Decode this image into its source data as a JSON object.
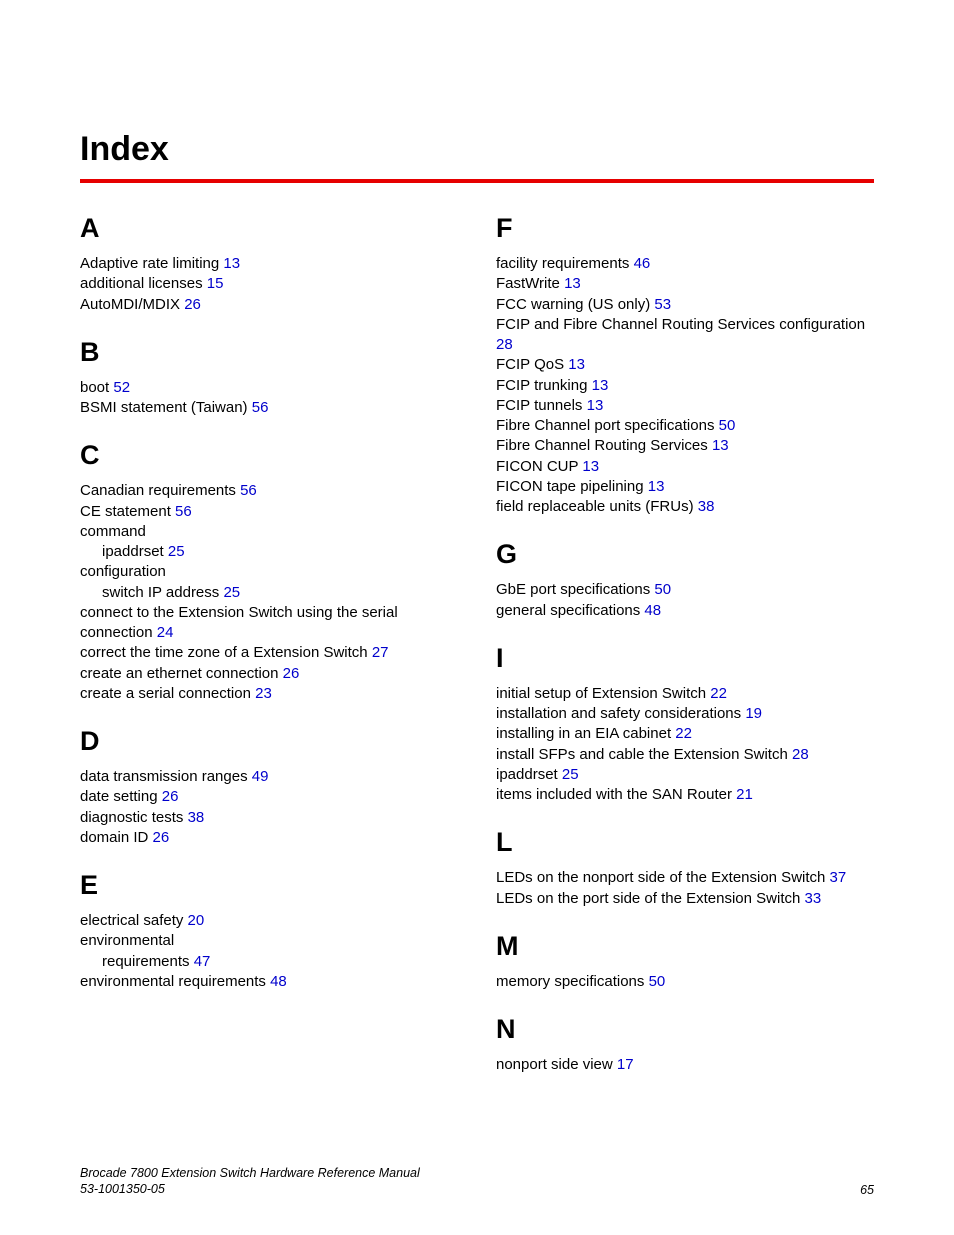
{
  "title": "Index",
  "footer": {
    "line1": "Brocade 7800 Extension Switch Hardware Reference Manual",
    "line2": "53-1001350-05",
    "page": "65"
  },
  "left": [
    {
      "letter": "A",
      "entries": [
        {
          "text": "Adaptive rate limiting ",
          "page": "13"
        },
        {
          "text": "additional licenses ",
          "page": "15"
        },
        {
          "text": "AutoMDI/MDIX ",
          "page": "26"
        }
      ]
    },
    {
      "letter": "B",
      "entries": [
        {
          "text": "boot ",
          "page": "52"
        },
        {
          "text": "BSMI statement (Taiwan) ",
          "page": "56"
        }
      ]
    },
    {
      "letter": "C",
      "entries": [
        {
          "text": "Canadian requirements ",
          "page": "56"
        },
        {
          "text": "CE statement ",
          "page": "56"
        },
        {
          "text": "command",
          "page": ""
        },
        {
          "text": "ipaddrset ",
          "page": "25",
          "sub": true
        },
        {
          "text": "configuration",
          "page": ""
        },
        {
          "text": "switch IP address ",
          "page": "25",
          "sub": true
        },
        {
          "text": "connect to the Extension Switch using the serial connection ",
          "page": "24"
        },
        {
          "text": "correct the time zone of a Extension Switch ",
          "page": "27"
        },
        {
          "text": "create an ethernet connection ",
          "page": "26"
        },
        {
          "text": "create a serial connection ",
          "page": "23"
        }
      ]
    },
    {
      "letter": "D",
      "entries": [
        {
          "text": "data transmission ranges ",
          "page": "49"
        },
        {
          "text": "date setting ",
          "page": "26"
        },
        {
          "text": "diagnostic tests ",
          "page": "38"
        },
        {
          "text": "domain ID ",
          "page": "26"
        }
      ]
    },
    {
      "letter": "E",
      "entries": [
        {
          "text": "electrical safety ",
          "page": "20"
        },
        {
          "text": "environmental",
          "page": ""
        },
        {
          "text": "requirements ",
          "page": "47",
          "sub": true
        },
        {
          "text": "environmental requirements ",
          "page": "48"
        }
      ]
    }
  ],
  "right": [
    {
      "letter": "F",
      "entries": [
        {
          "text": "facility requirements ",
          "page": "46"
        },
        {
          "text": "FastWrite ",
          "page": "13"
        },
        {
          "text": "FCC warning (US only) ",
          "page": "53"
        },
        {
          "text": "FCIP and Fibre Channel Routing Services configuration ",
          "page": "28"
        },
        {
          "text": "FCIP QoS ",
          "page": "13"
        },
        {
          "text": "FCIP trunking ",
          "page": "13"
        },
        {
          "text": "FCIP tunnels ",
          "page": "13"
        },
        {
          "text": "Fibre Channel port specifications ",
          "page": "50"
        },
        {
          "text": "Fibre Channel Routing Services ",
          "page": "13"
        },
        {
          "text": "FICON CUP ",
          "page": "13"
        },
        {
          "text": "FICON tape pipelining ",
          "page": "13"
        },
        {
          "text": "field replaceable units (FRUs) ",
          "page": "38"
        }
      ]
    },
    {
      "letter": "G",
      "entries": [
        {
          "text": "GbE port specifications ",
          "page": "50"
        },
        {
          "text": "general specifications ",
          "page": "48"
        }
      ]
    },
    {
      "letter": "I",
      "entries": [
        {
          "text": "initial setup of Extension Switch ",
          "page": "22"
        },
        {
          "text": "installation and safety considerations ",
          "page": "19"
        },
        {
          "text": "installing in an EIA cabinet ",
          "page": "22"
        },
        {
          "text": "install SFPs and cable the Extension Switch ",
          "page": "28"
        },
        {
          "text": "ipaddrset ",
          "page": "25"
        },
        {
          "text": "items included with the SAN Router ",
          "page": "21"
        }
      ]
    },
    {
      "letter": "L",
      "entries": [
        {
          "text": "LEDs on the nonport side of the Extension Switch ",
          "page": "37"
        },
        {
          "text": "LEDs on the port side of the Extension Switch ",
          "page": "33"
        }
      ]
    },
    {
      "letter": "M",
      "entries": [
        {
          "text": "memory specifications ",
          "page": "50"
        }
      ]
    },
    {
      "letter": "N",
      "entries": [
        {
          "text": "nonport side view ",
          "page": "17"
        }
      ]
    }
  ]
}
